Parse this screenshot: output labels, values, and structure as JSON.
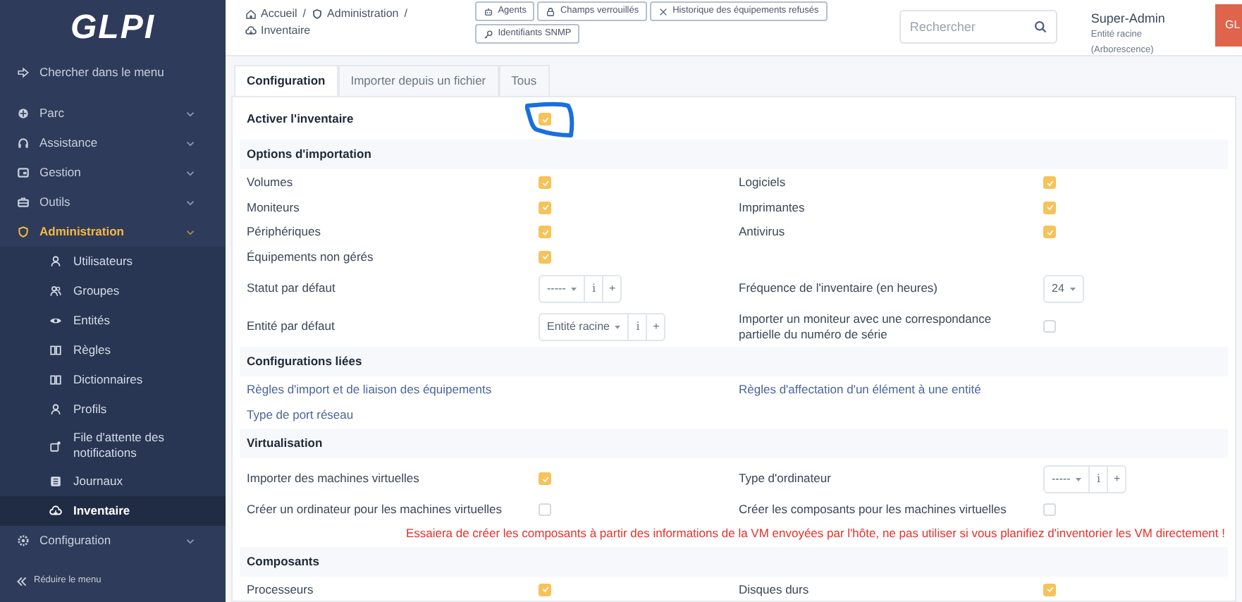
{
  "sidebar": {
    "logo": "GLPI",
    "search": "Chercher dans le menu",
    "items": [
      {
        "label": "Parc",
        "active": false
      },
      {
        "label": "Assistance",
        "active": false
      },
      {
        "label": "Gestion",
        "active": false
      },
      {
        "label": "Outils",
        "active": false
      },
      {
        "label": "Administration",
        "active": true,
        "children": [
          {
            "label": "Utilisateurs",
            "selected": false
          },
          {
            "label": "Groupes",
            "selected": false
          },
          {
            "label": "Entités",
            "selected": false
          },
          {
            "label": "Règles",
            "selected": false
          },
          {
            "label": "Dictionnaires",
            "selected": false
          },
          {
            "label": "Profils",
            "selected": false
          },
          {
            "label": "File d'attente des notifications",
            "selected": false
          },
          {
            "label": "Journaux",
            "selected": false
          },
          {
            "label": "Inventaire",
            "selected": true
          }
        ]
      },
      {
        "label": "Configuration",
        "active": false
      }
    ],
    "collapse": "Réduire le menu"
  },
  "header": {
    "breadcrumbs": [
      {
        "label": "Accueil",
        "separator": "/"
      },
      {
        "label": "Administration",
        "separator": "/"
      },
      {
        "label": "Inventaire"
      }
    ],
    "actions": [
      {
        "label": "Agents"
      },
      {
        "label": "Champs verrouillés"
      },
      {
        "label": "Historique des équipements refusés"
      },
      {
        "label": "Identifiants SNMP"
      }
    ],
    "search": {
      "placeholder": "Rechercher"
    },
    "user": {
      "name": "Super-Admin",
      "entity": "Entité racine (Arborescence)",
      "initials": "GL"
    }
  },
  "tabs": [
    {
      "label": "Configuration",
      "selected": true
    },
    {
      "label": "Importer depuis un fichier",
      "selected": false
    },
    {
      "label": "Tous",
      "selected": false
    }
  ],
  "form": [
    {
      "kind": "row",
      "left": {
        "kind": "checkbox",
        "label": "Activer l'inventaire",
        "checked": true,
        "highlighted": true
      }
    },
    {
      "kind": "section",
      "title": "Options d'importation"
    },
    {
      "kind": "row",
      "left": {
        "kind": "checkbox",
        "label": "Volumes",
        "checked": true
      },
      "right": {
        "kind": "checkbox",
        "label": "Logiciels",
        "checked": true
      }
    },
    {
      "kind": "row",
      "left": {
        "kind": "checkbox",
        "label": "Moniteurs",
        "checked": true
      },
      "right": {
        "kind": "checkbox",
        "label": "Imprimantes",
        "checked": true
      }
    },
    {
      "kind": "row",
      "left": {
        "kind": "checkbox",
        "label": "Périphériques",
        "checked": true
      },
      "right": {
        "kind": "checkbox",
        "label": "Antivirus",
        "checked": true
      }
    },
    {
      "kind": "row",
      "left": {
        "kind": "checkbox",
        "label": "Équipements non gérés",
        "checked": true
      }
    },
    {
      "kind": "row",
      "left": {
        "kind": "select",
        "label": "Statut par défaut",
        "value": "-----",
        "buttons": [
          "i",
          "+"
        ]
      },
      "right": {
        "kind": "select",
        "label": "Fréquence de l'inventaire (en heures)",
        "value": "24"
      }
    },
    {
      "kind": "row",
      "left": {
        "kind": "select",
        "label": "Entité par défaut",
        "value": "Entité racine",
        "buttons": [
          "i",
          "+"
        ]
      },
      "right": {
        "kind": "checkbox",
        "label": "Importer un moniteur avec une correspondance partielle du numéro de série",
        "checked": false
      }
    },
    {
      "kind": "section",
      "title": "Configurations liées"
    },
    {
      "kind": "row",
      "left": {
        "kind": "link",
        "label": "Règles d'import et de liaison des équipements"
      },
      "right": {
        "kind": "link",
        "label": "Règles d'affectation d'un élément à une entité"
      }
    },
    {
      "kind": "row",
      "left": {
        "kind": "link",
        "label": "Type de port réseau"
      }
    },
    {
      "kind": "section",
      "title": "Virtualisation"
    },
    {
      "kind": "row",
      "left": {
        "kind": "checkbox",
        "label": "Importer des machines virtuelles",
        "checked": true
      },
      "right": {
        "kind": "select",
        "label": "Type d'ordinateur",
        "value": "-----",
        "buttons": [
          "i",
          "+"
        ]
      }
    },
    {
      "kind": "row",
      "left": {
        "kind": "checkbox",
        "label": "Créer un ordinateur pour les machines virtuelles",
        "checked": false
      },
      "right": {
        "kind": "checkbox",
        "label": "Créer les composants pour les machines virtuelles",
        "checked": false
      }
    },
    {
      "kind": "note",
      "text": "Essaiera de créer les composants à partir des informations de la VM envoyées par l'hôte, ne pas utiliser si vous planifiez d'inventorier les VM directement !"
    },
    {
      "kind": "section",
      "title": "Composants"
    },
    {
      "kind": "row",
      "left": {
        "kind": "checkbox",
        "label": "Processeurs",
        "checked": true
      },
      "right": {
        "kind": "checkbox",
        "label": "Disques durs",
        "checked": true
      }
    }
  ]
}
